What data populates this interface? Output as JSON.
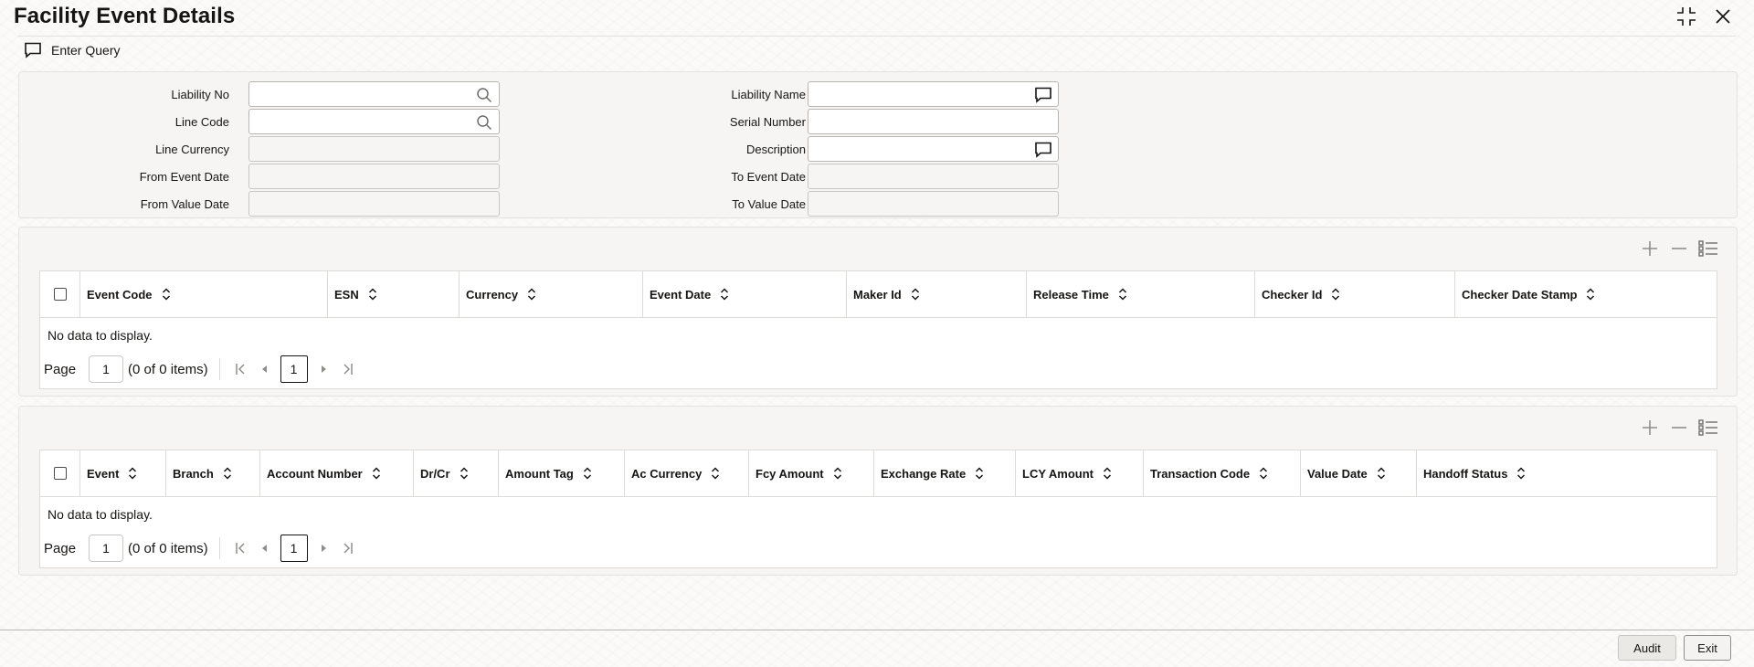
{
  "window": {
    "title": "Facility Event Details",
    "restore_icon": "collapse-icon",
    "close_icon": "close-icon"
  },
  "toolbar": {
    "enter_query_label": "Enter Query",
    "enter_query_icon": "comment-icon"
  },
  "query_form": {
    "liability_no": {
      "label": "Liability No",
      "value": "",
      "icon": "search-icon"
    },
    "line_code": {
      "label": "Line Code",
      "value": "",
      "icon": "search-icon"
    },
    "line_currency": {
      "label": "Line Currency",
      "value": ""
    },
    "from_event_date": {
      "label": "From Event Date",
      "value": ""
    },
    "from_value_date": {
      "label": "From Value Date",
      "value": ""
    },
    "liability_name": {
      "label": "Liability Name",
      "value": "",
      "icon": "comment-icon"
    },
    "serial_number": {
      "label": "Serial Number",
      "value": ""
    },
    "description": {
      "label": "Description",
      "value": "",
      "icon": "comment-icon"
    },
    "to_event_date": {
      "label": "To Event Date",
      "value": ""
    },
    "to_value_date": {
      "label": "To Value Date",
      "value": ""
    }
  },
  "events_table": {
    "actions": [
      "add-icon",
      "remove-icon",
      "column-list-icon"
    ],
    "columns": [
      "Event Code",
      "ESN",
      "Currency",
      "Event Date",
      "Maker Id",
      "Release Time",
      "Checker Id",
      "Checker Date Stamp"
    ],
    "rows": [],
    "empty_text": "No data to display.",
    "pager": {
      "page_label": "Page",
      "page_value": "1",
      "items_info": "(0 of 0 items)",
      "current_page": "1"
    }
  },
  "accounting_table": {
    "actions": [
      "add-icon",
      "remove-icon",
      "column-list-icon"
    ],
    "columns": [
      "Event",
      "Branch",
      "Account Number",
      "Dr/Cr",
      "Amount Tag",
      "Ac Currency",
      "Fcy Amount",
      "Exchange Rate",
      "LCY Amount",
      "Transaction Code",
      "Value Date",
      "Handoff Status"
    ],
    "rows": [],
    "empty_text": "No data to display.",
    "pager": {
      "page_label": "Page",
      "page_value": "1",
      "items_info": "(0 of 0 items)",
      "current_page": "1"
    }
  },
  "footer": {
    "audit_label": "Audit",
    "exit_label": "Exit"
  }
}
